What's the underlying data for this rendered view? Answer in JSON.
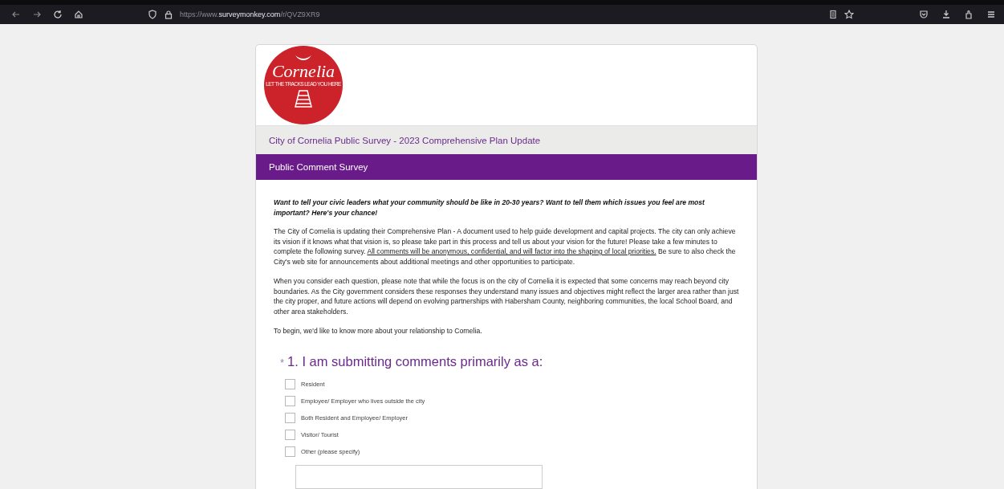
{
  "browser": {
    "url_prefix": "https://www.",
    "url_domain": "surveymonkey.com",
    "url_path": "/r/QVZ9XR9"
  },
  "logo": {
    "name": "Cornelia",
    "tagline": "LET THE TRACKS LEAD YOU HERE"
  },
  "survey_title": "City of Cornelia Public Survey - 2023 Comprehensive Plan Update",
  "page_title": "Public Comment Survey",
  "intro_lead": "Want to tell your civic leaders what your community should be like in 20-30 years?  Want to tell them which issues you feel are most important?  Here's your chance!",
  "paragraphs": [
    {
      "parts": [
        {
          "text": "The City of Cornelia is updating their Comprehensive Plan - A document used to help guide development and capital projects.  The city can only achieve its vision if it knows what that vision is, so please take part in this process and tell us about your vision for the future!  Please take a few minutes to complete the following survey.  ",
          "underline": false
        },
        {
          "text": "All comments will be anonymous, confidential, and will factor into the shaping of local priorities.",
          "underline": true
        },
        {
          "text": "  Be sure to also check the City's web site for announcements about additional meetings and other opportunities to participate.",
          "underline": false
        }
      ]
    },
    {
      "parts": [
        {
          "text": "When you consider each question, please note that while the focus is on the city of Cornelia it is expected that some concerns may reach beyond city boundaries.  As the City government considers these responses they understand many issues and objectives might reflect the larger area rather than just the city proper, and future actions will depend on evolving partnerships with Habersham County, neighboring communities, the local School Board, and other area stakeholders.",
          "underline": false
        }
      ]
    },
    {
      "parts": [
        {
          "text": "To begin, we'd like to know more about your relationship to Cornelia.",
          "underline": false
        }
      ]
    }
  ],
  "question": {
    "required_mark": "*",
    "title": "1. I am submitting comments primarily as a:",
    "options": [
      {
        "label": "Resident",
        "checked": false
      },
      {
        "label": "Employee/ Employer who lives outside the city",
        "checked": false
      },
      {
        "label": "Both Resident and Employee/ Employer",
        "checked": false
      },
      {
        "label": "Visitor/ Tourist",
        "checked": false
      },
      {
        "label": "Other (please specify)",
        "checked": false
      }
    ]
  }
}
